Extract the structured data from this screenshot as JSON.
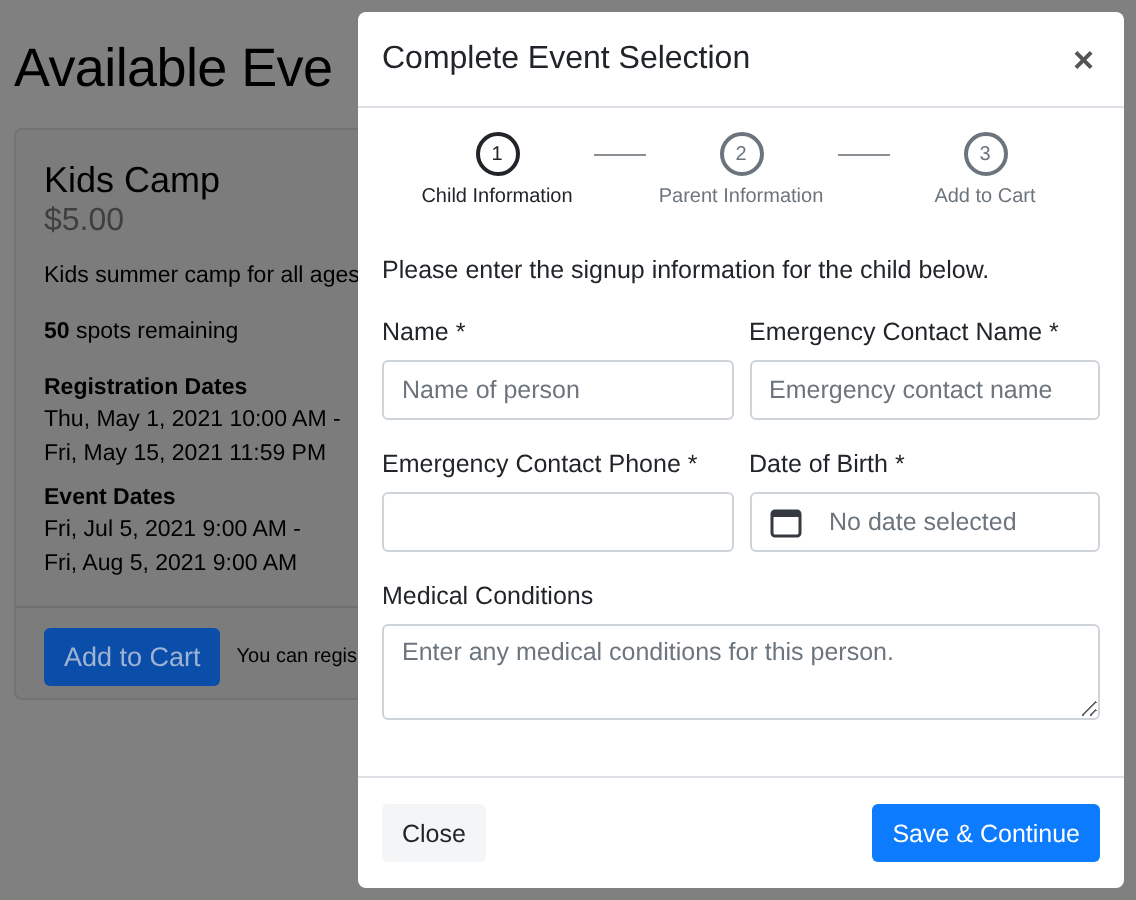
{
  "page": {
    "heading": "Available Eve",
    "card": {
      "title": "Kids Camp",
      "price": "$5.00",
      "description": "Kids summer camp for all ages",
      "spots": "**50** spots remaining",
      "sections": [
        {
          "heading": "Registration Dates",
          "lines": [
            "Thu, May 1, 2021 10:00 AM -",
            "Fri, May 15, 2021 11:59 PM"
          ]
        },
        {
          "heading": "Event Dates",
          "lines": [
            "Fri, Jul 5, 2021 9:00 AM -",
            "Fri, Aug 5, 2021 9:00 AM"
          ]
        }
      ],
      "button": "Add to Cart",
      "note": "You can regis"
    }
  },
  "modal": {
    "title": "Complete Event Selection",
    "close": "×",
    "steps": [
      {
        "number": "1",
        "label": "Child Information",
        "selected": true
      },
      {
        "number": "2",
        "label": "Parent Information",
        "selected": false
      },
      {
        "number": "3",
        "label": "Add to Cart",
        "selected": false
      }
    ],
    "prompt": "Please enter the signup information for the child below.",
    "fields": [
      {
        "kind": "text",
        "label": "Name *",
        "placeholder": "Name of person"
      },
      {
        "kind": "text",
        "label": "Emergency Contact Name *",
        "placeholder": "Emergency contact name"
      },
      {
        "kind": "text",
        "label": "Emergency Contact Phone *"
      },
      {
        "kind": "date",
        "label": "Date of Birth *",
        "value": "No date selected"
      },
      {
        "kind": "textarea",
        "label": "Medical Conditions",
        "placeholder": "Enter any medical conditions for this person."
      }
    ],
    "buttons": [
      {
        "kind": "secondary",
        "label": "Close"
      },
      {
        "kind": "primary",
        "label": "Save & Continue"
      }
    ]
  }
}
